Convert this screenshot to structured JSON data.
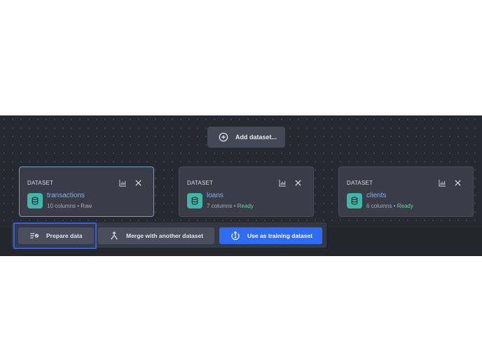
{
  "toolbar_top": {
    "add_dataset_label": "Add dataset..."
  },
  "datasets": [
    {
      "kind": "DATASET",
      "name": "transactions",
      "columns": "10 columns",
      "separator": " • ",
      "status": "Raw"
    },
    {
      "kind": "DATASET",
      "name": "loans",
      "columns": "7 columns",
      "separator": " • ",
      "status": "Ready"
    },
    {
      "kind": "DATASET",
      "name": "clients",
      "columns": "6 columns",
      "separator": " • ",
      "status": "Ready"
    }
  ],
  "actions": {
    "prepare_label": "Prepare data",
    "merge_label": "Merge with another dataset",
    "train_label": "Use as training dataset"
  },
  "colors": {
    "canvas": "#272932",
    "accent": "#2f6cf6",
    "dataset_icon": "#3fb6a6",
    "link": "#7fb2ee",
    "ready": "#6fcf97"
  },
  "icons": [
    "plus-circle-icon",
    "bar-chart-icon",
    "close-icon",
    "database-icon",
    "list-check-icon",
    "merge-icon",
    "training-icon"
  ]
}
